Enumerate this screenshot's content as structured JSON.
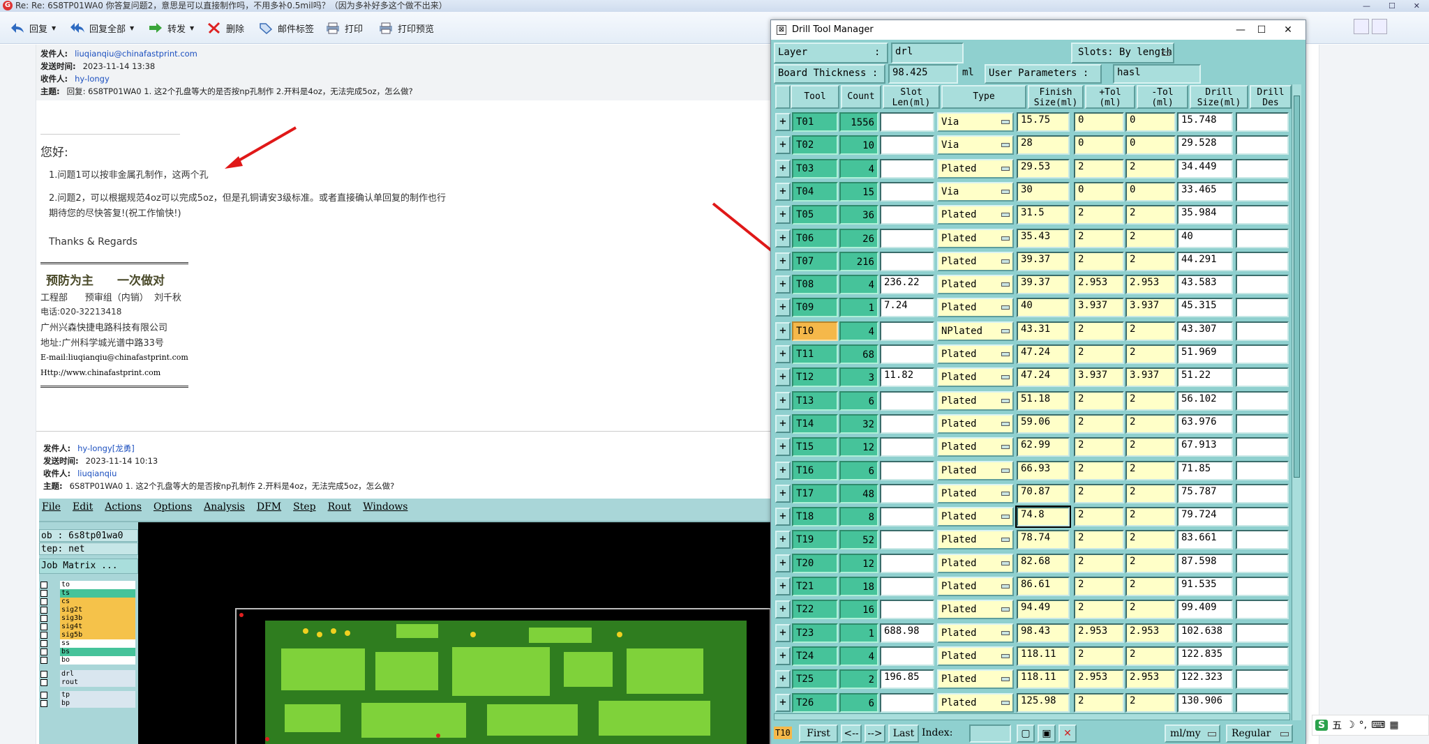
{
  "mail": {
    "window_title": "Re: Re: 6S8TP01WA0   你答复问题2，意思是可以直接制作吗，不用多补0.5mil吗？（因为多补好多这个做不出来）",
    "toolbar": {
      "reply": "回复",
      "reply_all": "回复全部",
      "forward": "转发",
      "delete": "删除",
      "mail_tag": "邮件标签",
      "print": "打印",
      "print_preview": "打印预览"
    },
    "header1": {
      "from_label": "发件人:",
      "from": "liuqianqiu@chinafastprint.com",
      "time_label": "发送时间:",
      "time": "2023-11-14 13:38",
      "to_label": "收件人:",
      "to": "hy-longy",
      "subject_label": "主题:",
      "subject": "回复: 6S8TP01WA0 1. 这2个孔盘等大的是否按np孔制作 2.开料是4oz，无法完成5oz，怎么做?"
    },
    "body": {
      "greeting": "您好:",
      "line1": "1.问题1可以按非金属孔制作，这两个孔",
      "line2": "2.问题2，可以根据规范4oz可以完成5oz，但是孔铜请安3级标准。或者直接确认单回复的制作也行",
      "line3": "期待您的尽快答复!(祝工作愉快!)",
      "regards": "Thanks & Regards",
      "slogan1": "预防为主",
      "slogan2": "一次做对",
      "dept": "工程部      预审组（内销）  刘千秋",
      "phone": "电话:020-32213418",
      "company": "广州兴森快捷电路科技有限公司",
      "address": "地址:广州科学城光谱中路33号",
      "email": "E-mail:liuqianqiu@chinafastprint.com",
      "web": "Http://www.chinafastprint.com"
    },
    "header2": {
      "from_label": "发件人:",
      "from": "hy-longy[龙勇]",
      "time_label": "发送时间:",
      "time": "2023-11-14 10:13",
      "to_label": "收件人:",
      "to": "liuqianqiu",
      "subject_label": "主题:",
      "subject": "6S8TP01WA0 1. 这2个孔盘等大的是否按np孔制作 2.开料是4oz，无法完成5oz，怎么做?"
    }
  },
  "genesis": {
    "menu": [
      "File",
      "Edit",
      "Actions",
      "Options",
      "Analysis",
      "DFM",
      "Step",
      "Rout",
      "Windows"
    ],
    "job": "ob : 6s8tp01wa0",
    "step": "tep: net",
    "job_matrix": "Job Matrix ...",
    "layers": [
      "to",
      "ts",
      "cs",
      "sig2t",
      "sig3b",
      "sig4t",
      "sig5b",
      "ss",
      "bs",
      "bo",
      "drl",
      "rout",
      "tp",
      "bp"
    ]
  },
  "drill": {
    "title": "Drill Tool Manager",
    "layer_label": "Layer",
    "layer_colon": ":",
    "layer_value": "drl",
    "slots_label": "Slots:",
    "slots_value": "By length",
    "thickness_label": "Board Thickness :",
    "thickness_value": "98.425",
    "thickness_unit": "ml",
    "user_params_label": "User Parameters :",
    "user_params_value": "hasl",
    "columns": [
      "Tool",
      "Count",
      "Slot\nLen(ml)",
      "Type",
      "Finish\nSize(ml)",
      "+Tol\n(ml)",
      "-Tol\n(ml)",
      "Drill\nSize(ml)",
      "Drill\nDes"
    ],
    "rows": [
      [
        "T01",
        "1556",
        "",
        "Via",
        "15.75",
        "0",
        "0",
        "15.748"
      ],
      [
        "T02",
        "10",
        "",
        "Via",
        "28",
        "0",
        "0",
        "29.528"
      ],
      [
        "T03",
        "4",
        "",
        "Plated",
        "29.53",
        "2",
        "2",
        "34.449"
      ],
      [
        "T04",
        "15",
        "",
        "Via",
        "30",
        "0",
        "0",
        "33.465"
      ],
      [
        "T05",
        "36",
        "",
        "Plated",
        "31.5",
        "2",
        "2",
        "35.984"
      ],
      [
        "T06",
        "26",
        "",
        "Plated",
        "35.43",
        "2",
        "2",
        "40"
      ],
      [
        "T07",
        "216",
        "",
        "Plated",
        "39.37",
        "2",
        "2",
        "44.291"
      ],
      [
        "T08",
        "4",
        "236.22",
        "Plated",
        "39.37",
        "2.953",
        "2.953",
        "43.583"
      ],
      [
        "T09",
        "1",
        "7.24",
        "Plated",
        "40",
        "3.937",
        "3.937",
        "45.315"
      ],
      [
        "T10",
        "4",
        "",
        "NPlated",
        "43.31",
        "2",
        "2",
        "43.307"
      ],
      [
        "T11",
        "68",
        "",
        "Plated",
        "47.24",
        "2",
        "2",
        "51.969"
      ],
      [
        "T12",
        "3",
        "11.82",
        "Plated",
        "47.24",
        "3.937",
        "3.937",
        "51.22"
      ],
      [
        "T13",
        "6",
        "",
        "Plated",
        "51.18",
        "2",
        "2",
        "56.102"
      ],
      [
        "T14",
        "32",
        "",
        "Plated",
        "59.06",
        "2",
        "2",
        "63.976"
      ],
      [
        "T15",
        "12",
        "",
        "Plated",
        "62.99",
        "2",
        "2",
        "67.913"
      ],
      [
        "T16",
        "6",
        "",
        "Plated",
        "66.93",
        "2",
        "2",
        "71.85"
      ],
      [
        "T17",
        "48",
        "",
        "Plated",
        "70.87",
        "2",
        "2",
        "75.787"
      ],
      [
        "T18",
        "8",
        "",
        "Plated",
        "74.8",
        "2",
        "2",
        "79.724"
      ],
      [
        "T19",
        "52",
        "",
        "Plated",
        "78.74",
        "2",
        "2",
        "83.661"
      ],
      [
        "T20",
        "12",
        "",
        "Plated",
        "82.68",
        "2",
        "2",
        "87.598"
      ],
      [
        "T21",
        "18",
        "",
        "Plated",
        "86.61",
        "2",
        "2",
        "91.535"
      ],
      [
        "T22",
        "16",
        "",
        "Plated",
        "94.49",
        "2",
        "2",
        "99.409"
      ],
      [
        "T23",
        "1",
        "688.98",
        "Plated",
        "98.43",
        "2.953",
        "2.953",
        "102.638"
      ],
      [
        "T24",
        "4",
        "",
        "Plated",
        "118.11",
        "2",
        "2",
        "122.835"
      ],
      [
        "T25",
        "2",
        "196.85",
        "Plated",
        "118.11",
        "2.953",
        "2.953",
        "122.323"
      ],
      [
        "T26",
        "6",
        "",
        "Plated",
        "125.98",
        "2",
        "2",
        "130.906"
      ]
    ],
    "selected_tool": "T10",
    "bottom": {
      "current": "T10",
      "first": "First",
      "prev": "<--",
      "next": "-->",
      "last": "Last",
      "index_label": "Index:",
      "units": "ml/my",
      "mode": "Regular"
    }
  },
  "tray": {
    "ime": "五"
  }
}
